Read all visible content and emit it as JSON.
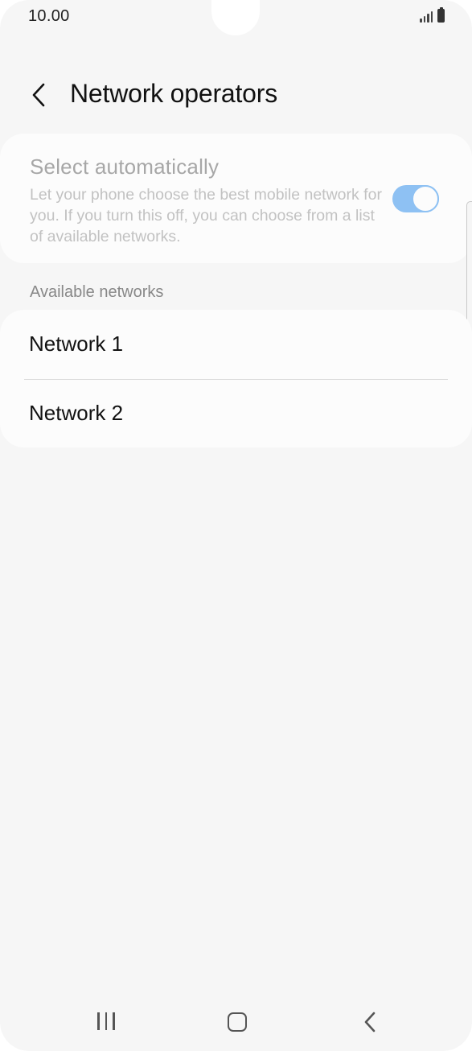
{
  "status_bar": {
    "time": "10.00",
    "icons": [
      "signal-icon",
      "battery-icon"
    ]
  },
  "header": {
    "back_icon": "chevron-left-icon",
    "title": "Network operators"
  },
  "select_automatically": {
    "title": "Select automatically",
    "description": "Let your phone choose the best mobile network for you. If you turn this off, you can choose from a list of available networks.",
    "toggle_on": true,
    "toggle_color": "#8ec1f3"
  },
  "available_networks": {
    "header": "Available networks",
    "items": [
      {
        "label": "Network 1"
      },
      {
        "label": "Network 2"
      }
    ]
  },
  "nav_bar": {
    "icons": [
      "recent-apps-icon",
      "home-icon",
      "back-icon"
    ]
  }
}
